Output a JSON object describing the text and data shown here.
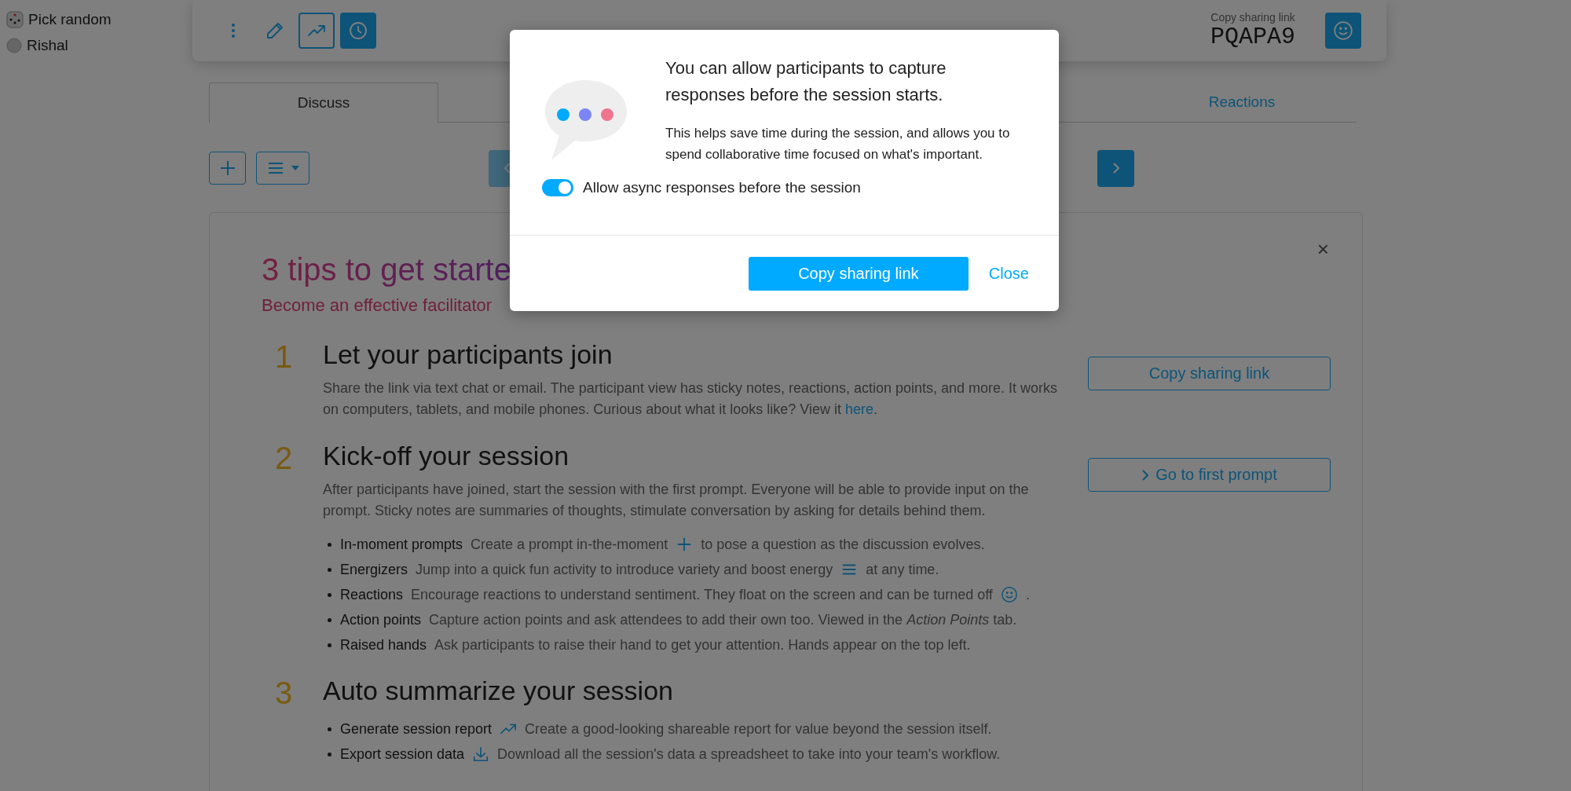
{
  "sidebar": {
    "items": [
      {
        "label": "Pick random",
        "kind": "dice"
      },
      {
        "label": "Rishal",
        "kind": "avatar"
      }
    ]
  },
  "toolbar": {
    "buttons": [
      {
        "kind": "more"
      },
      {
        "kind": "pencil"
      },
      {
        "kind": "trend"
      },
      {
        "kind": "clock"
      }
    ]
  },
  "share": {
    "label": "Copy sharing link",
    "code": "PQAPA9"
  },
  "tabs": [
    {
      "label": "Discuss",
      "selected": true
    },
    {
      "label": "Reactions",
      "selected": false
    }
  ],
  "nav": {
    "prev_disabled": true
  },
  "tips": {
    "close": "×",
    "title": "3 tips to get starte",
    "subtitle": "Become an effective facilitator",
    "steps": [
      {
        "number": "1",
        "heading": "Let your participants join",
        "text": "Share the link via text chat or email. The participant view has sticky notes, reactions, action points, and more. It works on computers, tablets, and mobile phones. Curious about what it looks like? View it",
        "link": "here",
        "after": ".",
        "button": {
          "label": "Copy sharing link",
          "kind": "copy"
        }
      },
      {
        "number": "2",
        "heading": "Kick-off your session",
        "text": "After participants have joined, start the session with the first prompt. Everyone will be able to provide input on the prompt. Sticky notes are summaries of thoughts, stimulate conversation by asking for details behind them.",
        "button": {
          "label": "Go to first prompt",
          "kind": "forward"
        },
        "bullets": [
          {
            "kind": "plus",
            "term": "In-moment prompts",
            "text": "Create a prompt in-the-moment",
            "after": "to pose a question as the discussion evolves."
          },
          {
            "kind": "menu",
            "term": "Energizers",
            "text": "Jump into a quick fun activity to introduce variety and boost energy",
            "after": "at any time."
          },
          {
            "kind": "smiley",
            "term": "Reactions",
            "text": "Encourage reactions to understand sentiment. They float on the screen and can be turned off",
            "after": "."
          },
          {
            "kind": "plain",
            "term": "Action points",
            "text": "Capture action points and ask attendees to add their own too. Viewed in the *Action Points* tab."
          },
          {
            "kind": "plain",
            "term": "Raised hands",
            "text": "Ask participants to raise their hand to get your attention. Hands appear on the top left."
          }
        ]
      },
      {
        "number": "3",
        "heading": "Auto summarize your session",
        "bullets": [
          {
            "kind": "trend",
            "term": "Generate session report",
            "text": "Create a good-looking shareable report for value beyond the session itself."
          },
          {
            "kind": "download",
            "term": "Export session data",
            "text": "Download all the session's data a spreadsheet to take into your team's workflow."
          }
        ]
      }
    ]
  },
  "modal": {
    "title": "You can allow participants to capture responses before the session starts.",
    "body": "This helps save time during the session, and allows you to spend collaborative time focused on what's important.",
    "toggle": {
      "label": "Allow async responses before the session",
      "on": true
    },
    "primary_button": "Copy sharing link",
    "close_button": "Close"
  }
}
